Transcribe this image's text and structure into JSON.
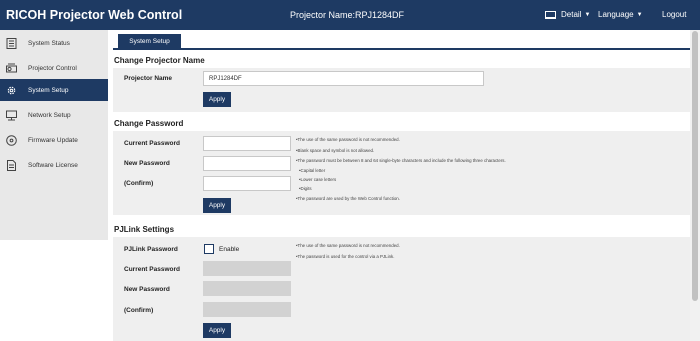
{
  "header": {
    "app_title": "RICOH Projector Web Control",
    "projector_name": "Projector Name:RPJ1284DF",
    "detail": "Detail",
    "language": "Language",
    "logout": "Logout"
  },
  "sidebar": {
    "items": [
      {
        "label": "System Status",
        "icon": "system-status-icon",
        "active": false
      },
      {
        "label": "Projector Control",
        "icon": "projector-icon",
        "active": false
      },
      {
        "label": "System Setup",
        "icon": "gear-icon",
        "active": true
      },
      {
        "label": "Network Setup",
        "icon": "network-icon",
        "active": false
      },
      {
        "label": "Firmware Update",
        "icon": "firmware-disc-icon",
        "active": false
      },
      {
        "label": "Software License",
        "icon": "document-icon",
        "active": false
      }
    ]
  },
  "tab": {
    "label": "System Setup"
  },
  "change_name": {
    "title": "Change Projector Name",
    "label": "Projector Name",
    "value": "RPJ1284DF",
    "apply": "Apply"
  },
  "change_password": {
    "title": "Change Password",
    "current_label": "Current Password",
    "new_label": "New Password",
    "confirm_label": "(Confirm)",
    "apply": "Apply",
    "notes": [
      "•The use of the same password is not recommended.",
      "•Blank space and symbol is not allowed.",
      "•The password must be between 8 and 64 single-byte characters and include the following three characters.",
      "•Capital letter",
      "•Lower case letters",
      "•Digits",
      "•The password are used by the Web Control function."
    ]
  },
  "pjlink": {
    "title": "PJLink Settings",
    "password_label": "PJLink Password",
    "enable_label": "Enable",
    "enabled": false,
    "current_label": "Current Password",
    "new_label": "New Password",
    "confirm_label": "(Confirm)",
    "apply": "Apply",
    "notes": [
      "•The use of the same password is not recommended.",
      "•The password is used for the control via a PJLink."
    ]
  },
  "colors": {
    "primary": "#1e3a63",
    "panel": "#efefef",
    "sidebar": "#e8e8e8",
    "disabled_field": "#d2d2d2"
  }
}
